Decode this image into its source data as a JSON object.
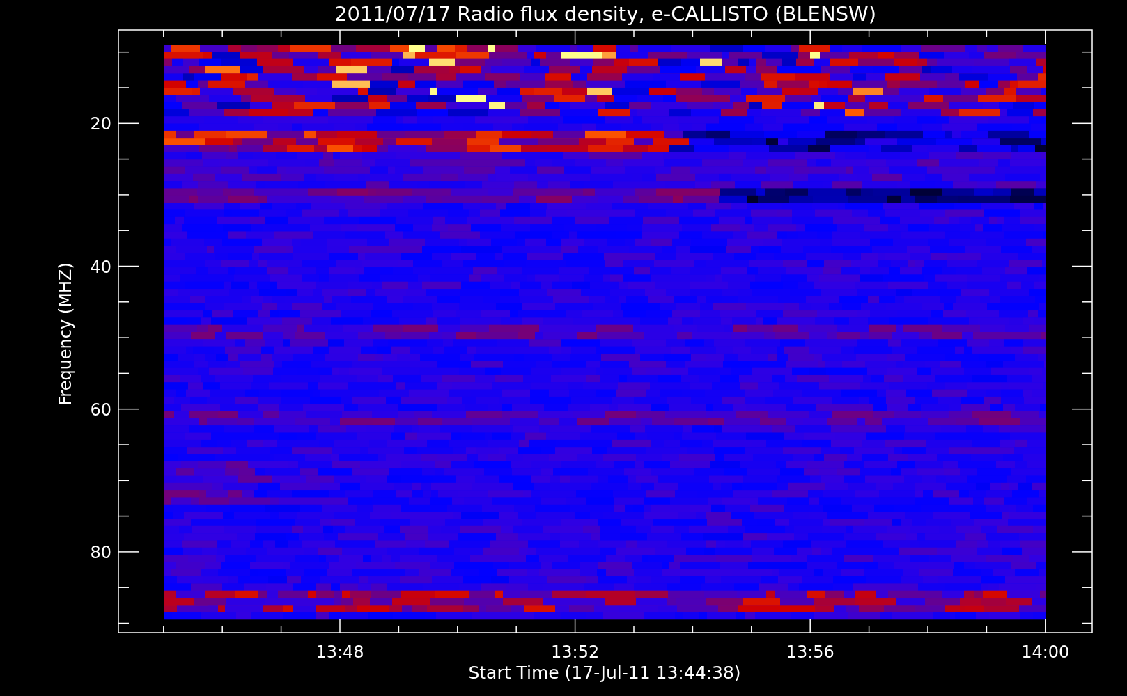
{
  "plot": {
    "title": "2011/07/17  Radio flux density, e-CALLISTO (BLENSW)",
    "y_axis": {
      "title": "Frequency (MHZ)",
      "tick_labels": [
        "20",
        "40",
        "60",
        "80"
      ]
    },
    "x_axis": {
      "title": "Start Time (17-Jul-11 13:44:38)",
      "tick_labels": [
        "13:48",
        "13:52",
        "13:56",
        "14:00"
      ]
    }
  }
}
